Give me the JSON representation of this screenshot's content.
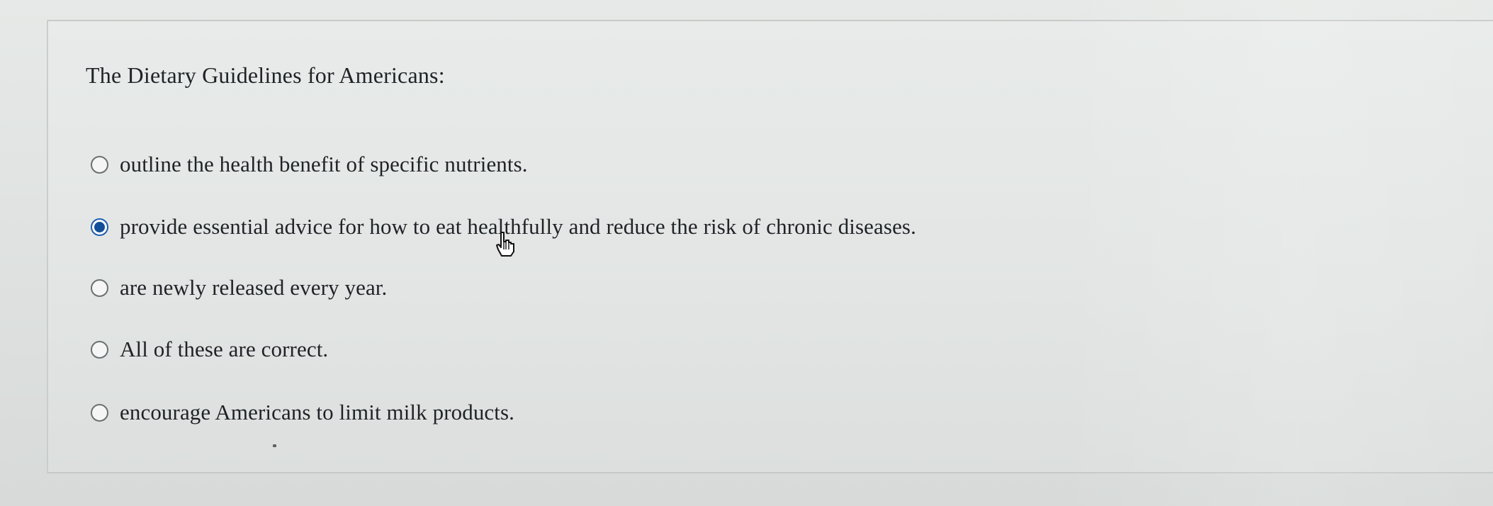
{
  "question": {
    "text": "The Dietary Guidelines for Americans:"
  },
  "options": [
    {
      "label": "outline the health benefit of specific nutrients.",
      "selected": false
    },
    {
      "label": "provide essential advice for how to eat healthfully and reduce the risk of chronic diseases.",
      "selected": true
    },
    {
      "label": "are newly released every year.",
      "selected": false
    },
    {
      "label": "All of these are correct.",
      "selected": false
    },
    {
      "label": "encourage Americans to limit milk products.",
      "selected": false
    }
  ],
  "colors": {
    "selected_radio": "#124e99",
    "text": "#1f2326",
    "background": "#dcdfde"
  },
  "icons": {
    "cursor": "pointer-cursor-icon",
    "radio_unselected": "radio-button-icon",
    "radio_selected": "radio-button-selected-icon"
  }
}
